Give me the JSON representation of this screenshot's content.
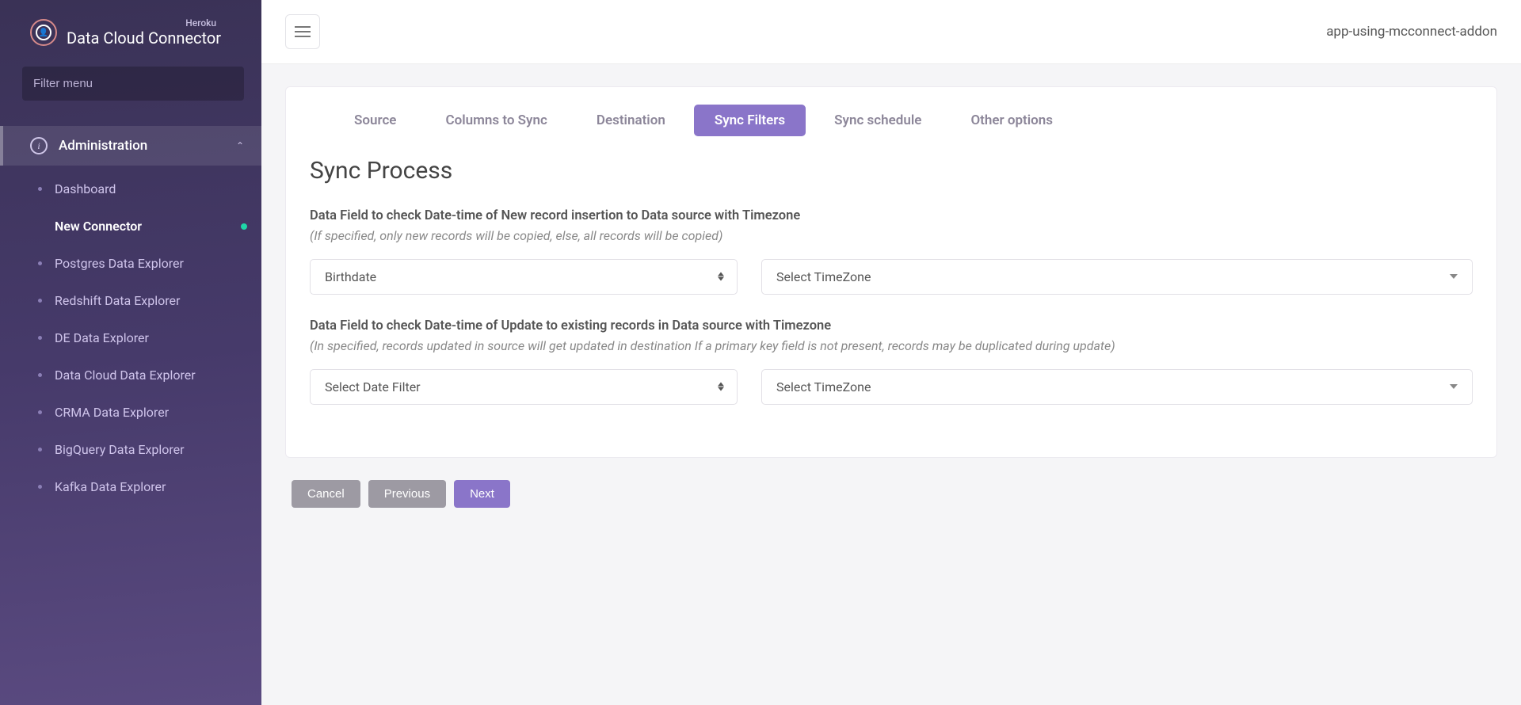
{
  "brand": {
    "subtitle": "Heroku",
    "title": "Data Cloud Connector"
  },
  "sidebar": {
    "filter_placeholder": "Filter menu",
    "section_label": "Administration",
    "items": [
      {
        "label": "Dashboard",
        "active": false
      },
      {
        "label": "New Connector",
        "active": true
      },
      {
        "label": "Postgres Data Explorer",
        "active": false
      },
      {
        "label": "Redshift Data Explorer",
        "active": false
      },
      {
        "label": "DE Data Explorer",
        "active": false
      },
      {
        "label": "Data Cloud Data Explorer",
        "active": false
      },
      {
        "label": "CRMA Data Explorer",
        "active": false
      },
      {
        "label": "BigQuery Data Explorer",
        "active": false
      },
      {
        "label": "Kafka Data Explorer",
        "active": false
      }
    ]
  },
  "header": {
    "app_name": "app-using-mcconnect-addon"
  },
  "tabs": [
    {
      "label": "Source",
      "active": false
    },
    {
      "label": "Columns to Sync",
      "active": false
    },
    {
      "label": "Destination",
      "active": false
    },
    {
      "label": "Sync Filters",
      "active": true
    },
    {
      "label": "Sync schedule",
      "active": false
    },
    {
      "label": "Other options",
      "active": false
    }
  ],
  "page": {
    "title": "Sync Process",
    "field1": {
      "label": "Data Field to check Date-time of New record insertion to Data source with Timezone",
      "hint": "(If specified, only new records will be copied, else, all records will be copied)",
      "date_value": "Birthdate",
      "tz_value": "Select TimeZone"
    },
    "field2": {
      "label": "Data Field to check Date-time of Update to existing records in Data source with Timezone",
      "hint": "(In specified, records updated in source will get updated in destination If a primary key field is not present, records may be duplicated during update)",
      "date_value": "Select Date Filter",
      "tz_value": "Select TimeZone"
    }
  },
  "actions": {
    "cancel": "Cancel",
    "previous": "Previous",
    "next": "Next"
  }
}
